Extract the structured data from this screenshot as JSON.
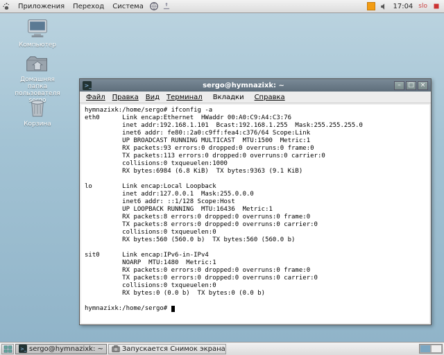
{
  "panel": {
    "menus": [
      "Приложения",
      "Переход",
      "Система"
    ],
    "time": "17:04",
    "tray_label": "slo"
  },
  "desktop": {
    "computer": "Компьютер",
    "home": "Домашняя папка\nпользователя\nsergo",
    "trash": "Корзина"
  },
  "window": {
    "title": "sergo@hymnazixk: ~",
    "menus": [
      "Файл",
      "Правка",
      "Вид",
      "Терминал",
      "Вкладки",
      "Справка"
    ]
  },
  "terminal": {
    "lines": [
      "hymnazixk:/home/sergo# ifconfig -a",
      "eth0      Link encap:Ethernet  HWaddr 00:A0:C9:A4:C3:76",
      "          inet addr:192.168.1.101  Bcast:192.168.1.255  Mask:255.255.255.0",
      "          inet6 addr: fe80::2a0:c9ff:fea4:c376/64 Scope:Link",
      "          UP BROADCAST RUNNING MULTICAST  MTU:1500  Metric:1",
      "          RX packets:93 errors:0 dropped:0 overruns:0 frame:0",
      "          TX packets:113 errors:0 dropped:0 overruns:0 carrier:0",
      "          collisions:0 txqueuelen:1000",
      "          RX bytes:6984 (6.8 KiB)  TX bytes:9363 (9.1 KiB)",
      "",
      "lo        Link encap:Local Loopback",
      "          inet addr:127.0.0.1  Mask:255.0.0.0",
      "          inet6 addr: ::1/128 Scope:Host",
      "          UP LOOPBACK RUNNING  MTU:16436  Metric:1",
      "          RX packets:8 errors:0 dropped:0 overruns:0 frame:0",
      "          TX packets:8 errors:0 dropped:0 overruns:0 carrier:0",
      "          collisions:0 txqueuelen:0",
      "          RX bytes:560 (560.0 b)  TX bytes:560 (560.0 b)",
      "",
      "sit0      Link encap:IPv6-in-IPv4",
      "          NOARP  MTU:1480  Metric:1",
      "          RX packets:0 errors:0 dropped:0 overruns:0 frame:0",
      "          TX packets:0 errors:0 dropped:0 overruns:0 carrier:0",
      "          collisions:0 txqueuelen:0",
      "          RX bytes:0 (0.0 b)  TX bytes:0 (0.0 b)",
      "",
      "hymnazixk:/home/sergo# "
    ]
  },
  "taskbar": {
    "task1": "sergo@hymnazixk: ~",
    "task2": "Запускается Снимок экрана"
  }
}
